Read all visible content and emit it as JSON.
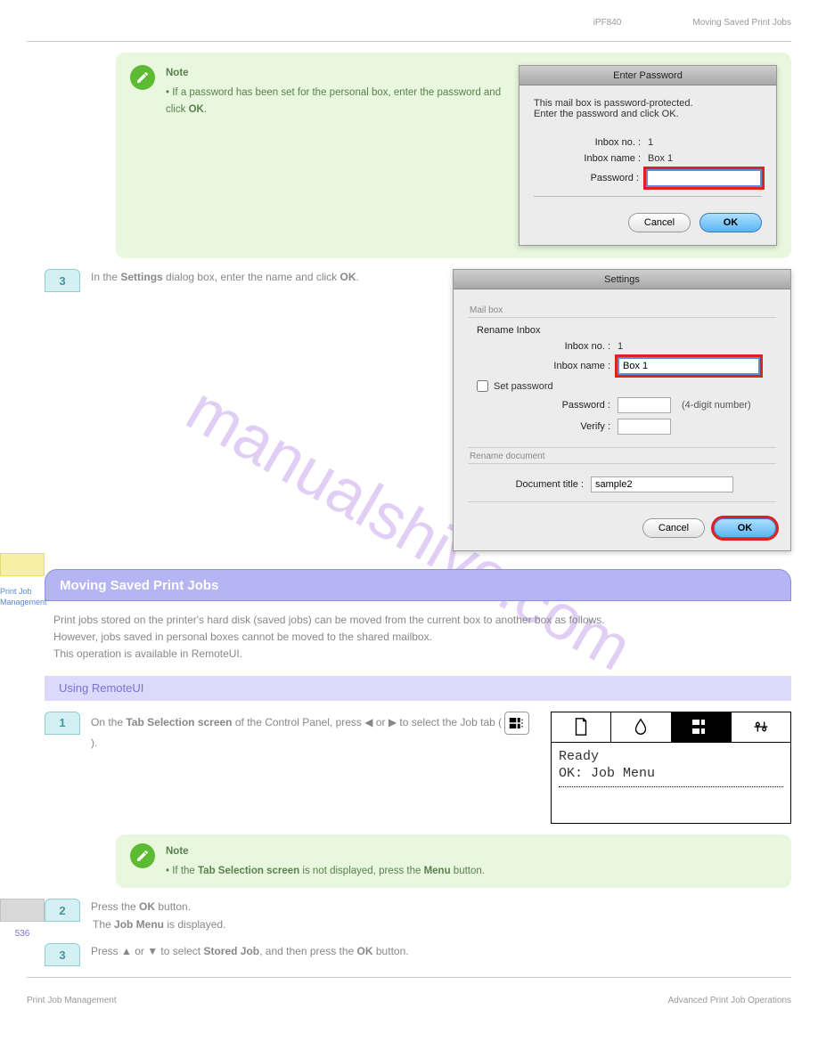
{
  "header": {
    "mid": "iPF840",
    "right": "Moving Saved Print Jobs"
  },
  "note1": {
    "label": "Note",
    "line1_a": "If a password has been set for the personal box, enter the password and click ",
    "line1_b": "OK",
    "line1_c": "."
  },
  "dialog1": {
    "title": "Enter Password",
    "message1": "This mail box is password-protected.",
    "message2": "Enter the password and click OK.",
    "inbox_no_label": "Inbox no. :",
    "inbox_no_value": "1",
    "inbox_name_label": "Inbox name :",
    "inbox_name_value": "Box 1",
    "password_label": "Password :",
    "password_value": "",
    "cancel": "Cancel",
    "ok": "OK"
  },
  "step1": {
    "num": "3",
    "line1_a": "In the ",
    "line1_b": "Settings",
    "line1_c": " dialog box, enter the name and click ",
    "line1_d": "OK",
    "line1_e": "."
  },
  "dialog2": {
    "title": "Settings",
    "mailbox_label": "Mail box",
    "rename_inbox": "Rename Inbox",
    "inbox_no_label": "Inbox no. :",
    "inbox_no_value": "1",
    "inbox_name_label": "Inbox name :",
    "inbox_name_value": "Box 1",
    "set_password": "Set password",
    "password_label": "Password :",
    "password_value": "",
    "four_digit": "(4-digit number)",
    "verify_label": "Verify :",
    "verify_value": "",
    "rename_doc_label": "Rename document",
    "doc_title_label": "Document title :",
    "doc_title_value": "sample2",
    "cancel": "Cancel",
    "ok": "OK"
  },
  "sidelinks": {
    "link1": "Print Job Management",
    "link2": "Advanced Print Job Operations"
  },
  "section_bar": "Moving Saved Print Jobs",
  "section_para": "Print jobs stored on the printer's hard disk (saved jobs) can be moved from the current box to another box as follows.\nHowever, jobs saved in personal boxes cannot be moved to the shared mailbox.\nThis operation is available in RemoteUI.",
  "sub_bar": "Using RemoteUI",
  "stepA": {
    "num": "1",
    "line_a": "On the ",
    "line_b": "Tab Selection screen",
    "line_c": " of the Control Panel, press ◀ or ▶ to select the Job tab (",
    "line_d": " )."
  },
  "lcd": {
    "line1": "Ready",
    "line2": "OK: Job Menu"
  },
  "note2": {
    "label": "Note",
    "line_a": "If the ",
    "line_b": "Tab Selection screen",
    "line_c": " is not displayed, press the ",
    "line_d": "Menu",
    "line_e": " button."
  },
  "stepB": {
    "num": "2",
    "line_a": "Press the ",
    "line_b": "OK",
    "line_c": " button.",
    "sub_a": "The ",
    "sub_b": "Job Menu",
    "sub_c": " is displayed."
  },
  "stepC": {
    "num": "3",
    "line_a": "Press ▲ or ▼ to select ",
    "line_b": "Stored Job",
    "line_c": ", and then press the ",
    "line_d": "OK",
    "line_e": " button."
  },
  "pagenum": "536",
  "footer": {
    "left": "Print Job Management",
    "right": "Advanced Print Job Operations"
  },
  "watermark": "manualshive.com"
}
